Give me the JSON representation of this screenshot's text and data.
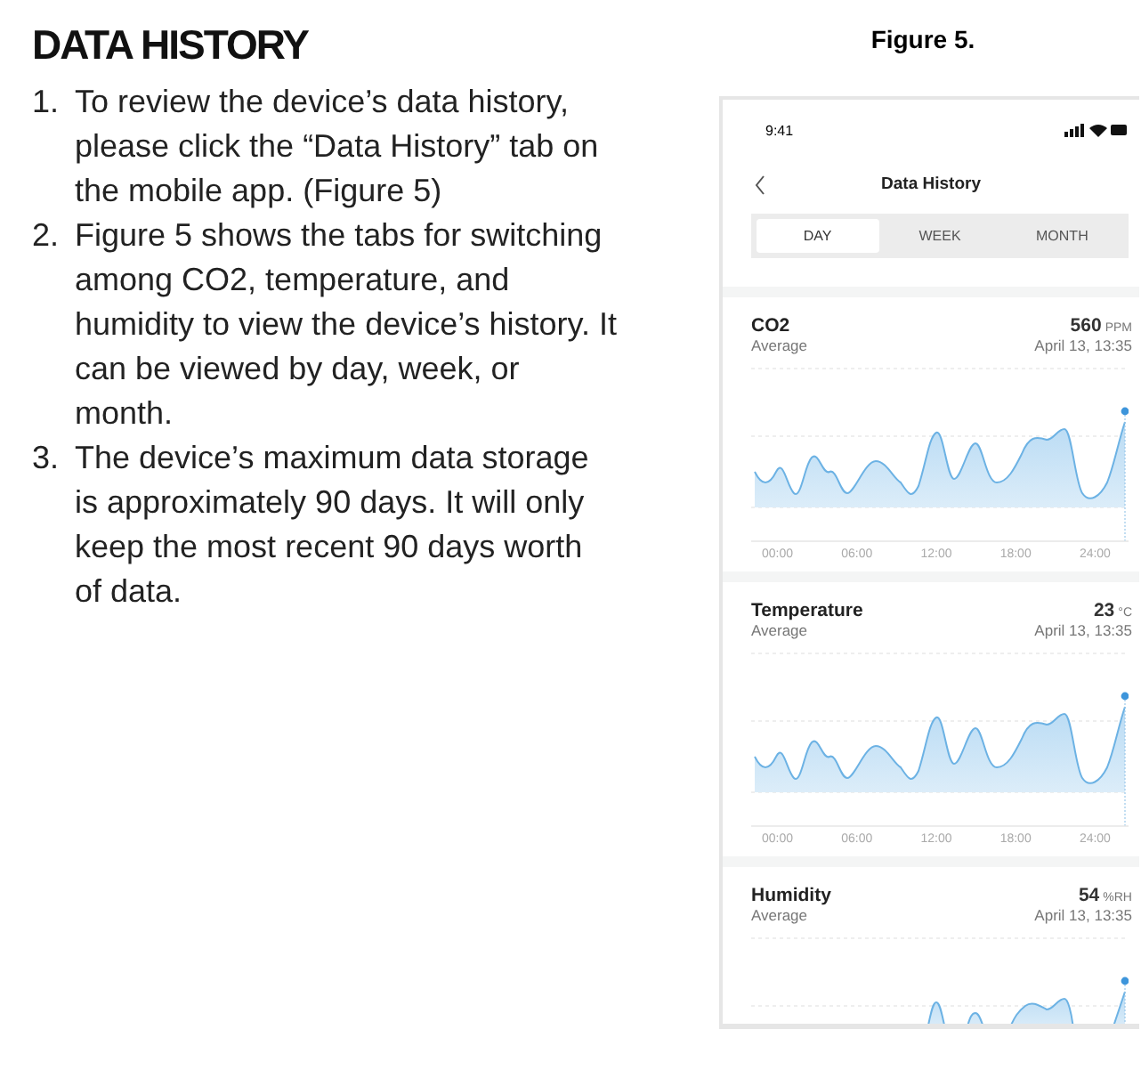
{
  "heading": "DATA HISTORY",
  "steps": [
    {
      "number": "1.",
      "text": "To review the device’s data history, please click the “Data History” tab on the mobile app. (Figure 5)"
    },
    {
      "number": "2.",
      "text": "Figure 5 shows the tabs for switching among CO2, temperature, and humidity to view the device’s history. It can be viewed by day, week, or month."
    },
    {
      "number": "3.",
      "text": "The device’s maximum data storage is approximately 90 days. It will only keep the most recent 90 days worth of data."
    }
  ],
  "figure_caption": "Figure 5.",
  "phone": {
    "status_time": "9:41",
    "title": "Data History",
    "tabs": [
      {
        "label": "DAY",
        "selected": true
      },
      {
        "label": "WEEK",
        "selected": false
      },
      {
        "label": "MONTH",
        "selected": false
      }
    ],
    "cards": [
      {
        "name": "CO2",
        "value": "560",
        "unit": "PPM",
        "subtitle": "Average",
        "timestamp": "April 13, 13:35",
        "x_labels": [
          "00:00",
          "06:00",
          "12:00",
          "18:00",
          "24:00"
        ]
      },
      {
        "name": "Temperature",
        "value": "23",
        "unit": "°C",
        "subtitle": "Average",
        "timestamp": "April 13, 13:35",
        "x_labels": [
          "00:00",
          "06:00",
          "12:00",
          "18:00",
          "24:00"
        ]
      },
      {
        "name": "Humidity",
        "value": "54",
        "unit": "%RH",
        "subtitle": "Average",
        "timestamp": "April 13, 13:35"
      }
    ]
  }
}
